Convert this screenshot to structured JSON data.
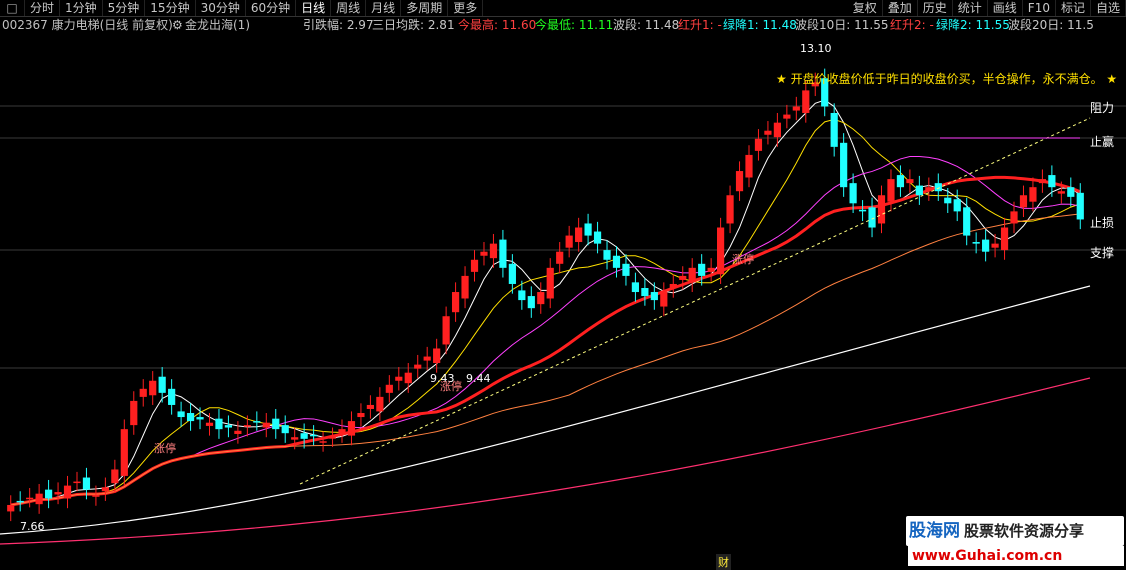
{
  "toolbar": {
    "left_items": [
      "分时",
      "1分钟",
      "5分钟",
      "15分钟",
      "30分钟",
      "60分钟",
      "日线",
      "周线",
      "月线",
      "多周期",
      "更多"
    ],
    "active": "日线",
    "right_items": [
      "复权",
      "叠加",
      "历史",
      "统计",
      "画线",
      "F10",
      "标记",
      "自选"
    ]
  },
  "info": {
    "code_name": "002367 康力电梯(日线 前复权)",
    "indicator": "金龙出海(1)",
    "items": [
      {
        "text": "引跌幅: 2.97",
        "color": "#c8c8c8"
      },
      {
        "text": "三日均跌: 2.81",
        "color": "#c8c8c8"
      },
      {
        "text": "今最高: 11.60",
        "color": "#ff4040"
      },
      {
        "text": "今最低: 11.11",
        "color": "#20ff20"
      },
      {
        "text": "波段: 11.48",
        "color": "#c8c8c8"
      },
      {
        "text": "红升1: -",
        "color": "#ff4040"
      },
      {
        "text": "绿降1: 11.48",
        "color": "#20ffff"
      },
      {
        "text": "波段10日: 11.55",
        "color": "#c8c8c8"
      },
      {
        "text": "红升2: -",
        "color": "#ff4040"
      },
      {
        "text": "绿降2: 11.55",
        "color": "#20ffff"
      },
      {
        "text": "波段20日: 11.5",
        "color": "#c8c8c8"
      }
    ]
  },
  "annotations": {
    "top_price": "13.10",
    "note": "开盘价收盘价低于昨日的收盘价买，半仓操作，永不满仓。",
    "resistance": "阻力",
    "take_profit": "止赢",
    "stop_loss": "止损",
    "support": "支撑",
    "low_price": "7.66",
    "price_a": "9.43",
    "price_b": "9.44",
    "limit_up": "涨停"
  },
  "watermark": {
    "brand": "股海网",
    "tagline": "股票软件资源分享",
    "url": "www.Guhai.com.cn"
  },
  "cai": "财",
  "chart_data": {
    "type": "candlestick",
    "ylim": [
      7.3,
      13.4
    ],
    "colors": {
      "up": "#ff2020",
      "down": "#20ffff",
      "ma_main": "#ff2020",
      "bg": "#000000"
    },
    "closes": [
      7.66,
      7.7,
      7.75,
      7.8,
      7.74,
      7.82,
      7.9,
      7.95,
      7.85,
      7.78,
      7.88,
      8.1,
      8.6,
      8.95,
      9.1,
      9.2,
      9.05,
      8.9,
      8.75,
      8.7,
      8.72,
      8.68,
      8.6,
      8.62,
      8.58,
      8.65,
      8.7,
      8.68,
      8.6,
      8.55,
      8.5,
      8.48,
      8.52,
      8.45,
      8.5,
      8.6,
      8.7,
      8.8,
      8.9,
      9.0,
      9.15,
      9.25,
      9.3,
      9.4,
      9.5,
      9.6,
      10.0,
      10.3,
      10.5,
      10.7,
      10.8,
      10.9,
      10.6,
      10.4,
      10.2,
      10.1,
      10.3,
      10.6,
      10.8,
      11.0,
      11.1,
      11.0,
      10.9,
      10.7,
      10.6,
      10.5,
      10.3,
      10.25,
      10.2,
      10.3,
      10.4,
      10.5,
      10.6,
      10.5,
      10.6,
      11.1,
      11.5,
      11.8,
      12.0,
      12.2,
      12.3,
      12.4,
      12.5,
      12.6,
      12.8,
      12.9,
      12.6,
      12.1,
      11.6,
      11.4,
      11.3,
      11.1,
      11.5,
      11.7,
      11.6,
      11.7,
      11.5,
      11.6,
      11.55,
      11.4,
      11.3,
      11.0,
      10.9,
      10.8,
      10.9,
      11.1,
      11.3,
      11.5,
      11.6,
      11.7,
      11.6,
      11.55,
      11.48,
      11.2
    ]
  }
}
